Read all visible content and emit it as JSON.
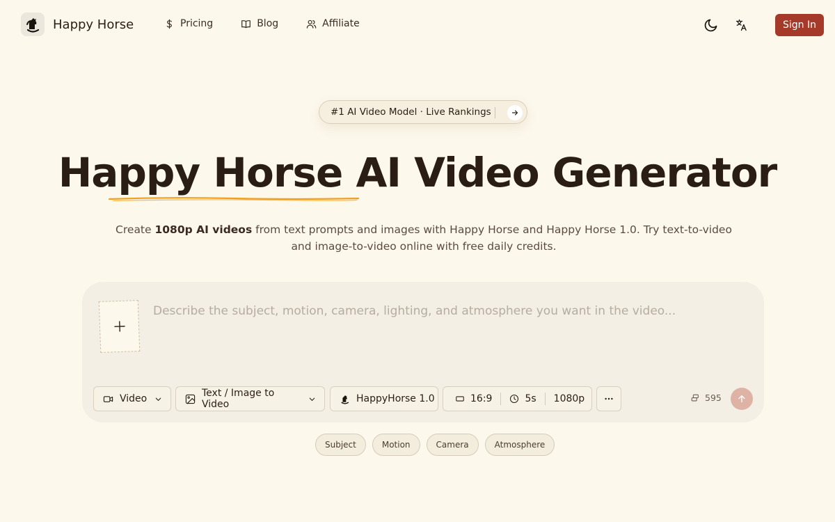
{
  "header": {
    "brand": "Happy Horse",
    "nav": [
      {
        "label": "Pricing",
        "icon": "dollar-icon"
      },
      {
        "label": "Blog",
        "icon": "book-icon"
      },
      {
        "label": "Affiliate",
        "icon": "users-icon"
      }
    ],
    "theme_icon": "moon-icon",
    "language_icon": "translate-icon",
    "sign_in": "Sign In"
  },
  "hero": {
    "badge": "#1 AI Video Model · Live Rankings",
    "title": "Happy Horse AI Video Generator",
    "subtitle_pre": "Create ",
    "subtitle_bold": "1080p AI videos",
    "subtitle_post": " from text prompts and images with Happy Horse and Happy Horse 1.0. Try text-to-video and image-to-video online with free daily credits."
  },
  "prompt": {
    "placeholder": "Describe the subject, motion, camera, lighting, and atmosphere you want in the video...",
    "value": ""
  },
  "controls": {
    "output_type": "Video",
    "mode": "Text / Image to Video",
    "model": "HappyHorse 1.0",
    "aspect_ratio": "16:9",
    "duration": "5s",
    "resolution": "1080p",
    "more_icon": "more-horizontal-icon",
    "credits": "595",
    "send_icon": "arrow-up-icon"
  },
  "chips": [
    "Subject",
    "Motion",
    "Camera",
    "Atmosphere"
  ],
  "colors": {
    "background": "#fdf8ec",
    "accent": "#a63a2a",
    "underline": "#f0a020",
    "prompt_bg": "#f3efe4",
    "send_disabled": "#deb2a5"
  }
}
